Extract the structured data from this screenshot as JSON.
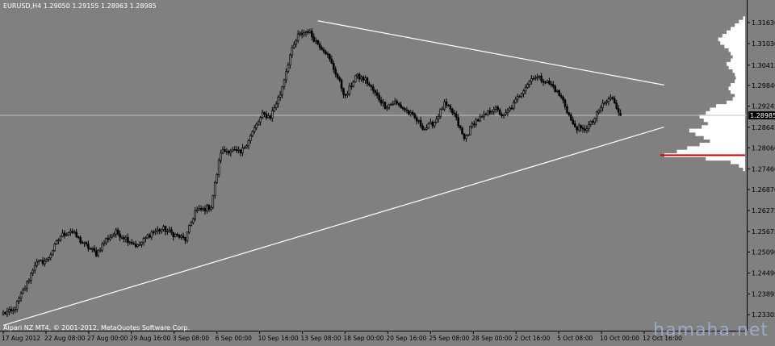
{
  "header": {
    "symbol_line": "EURUSD,H4  1.29050 1.29155 1.28963 1.28985"
  },
  "footer": {
    "copyright": "Alpari NZ MT4, © 2001-2012, MetaQuotes Software Corp."
  },
  "watermark": "hamaha.net",
  "colors": {
    "background": "#808080",
    "candle": "#000000",
    "trendline": "#ffffff",
    "price_line": "#c0c0c0",
    "axis_text": "#000000",
    "profile_fill": "#ffffff",
    "profile_peak": "#cc0000",
    "current_price_box": "#000000"
  },
  "chart_data": {
    "type": "candlestick",
    "symbol": "EURUSD",
    "timeframe": "H4",
    "current_price": 1.28985,
    "ohlc_last": {
      "open": 1.2905,
      "high": 1.29155,
      "low": 1.28963,
      "close": 1.28985
    },
    "ylim": [
      1.2285,
      1.3195
    ],
    "y_ticks": [
      1.3163,
      1.3103,
      1.30415,
      1.2984,
      1.29245,
      1.28645,
      1.2806,
      1.2746,
      1.2687,
      1.26275,
      1.25675,
      1.2509,
      1.2449,
      1.23895,
      1.23305
    ],
    "current_price_label": "1.28985",
    "x_ticks": [
      "17 Aug 2012",
      "22 Aug 08:00",
      "27 Aug 00:00",
      "29 Aug 16:00",
      "3 Sep 08:00",
      "6 Sep 00:00",
      "10 Sep 16:00",
      "13 Sep 08:00",
      "18 Sep 00:00",
      "20 Sep 16:00",
      "25 Sep 08:00",
      "28 Sep 00:00",
      "2 Oct 16:00",
      "5 Oct 08:00",
      "10 Oct 00:00",
      "12 Oct 16:00"
    ],
    "path_keypoints": [
      [
        0,
        1.2335
      ],
      [
        5,
        1.234
      ],
      [
        12,
        1.242
      ],
      [
        16,
        1.2475
      ],
      [
        22,
        1.2485
      ],
      [
        29,
        1.2555
      ],
      [
        34,
        1.257
      ],
      [
        40,
        1.2535
      ],
      [
        47,
        1.2505
      ],
      [
        52,
        1.2545
      ],
      [
        57,
        1.2565
      ],
      [
        63,
        1.2545
      ],
      [
        68,
        1.2525
      ],
      [
        75,
        1.2565
      ],
      [
        81,
        1.2575
      ],
      [
        86,
        1.256
      ],
      [
        92,
        1.2545
      ],
      [
        97,
        1.2625
      ],
      [
        101,
        1.263
      ],
      [
        105,
        1.264
      ],
      [
        110,
        1.2795
      ],
      [
        115,
        1.28
      ],
      [
        120,
        1.279
      ],
      [
        126,
        1.285
      ],
      [
        131,
        1.29
      ],
      [
        135,
        1.2895
      ],
      [
        140,
        1.296
      ],
      [
        145,
        1.307
      ],
      [
        149,
        1.3125
      ],
      [
        154,
        1.314
      ],
      [
        158,
        1.311
      ],
      [
        163,
        1.308
      ],
      [
        168,
        1.302
      ],
      [
        173,
        1.295
      ],
      [
        178,
        1.301
      ],
      [
        183,
        1.3
      ],
      [
        188,
        1.296
      ],
      [
        193,
        1.2925
      ],
      [
        198,
        1.2935
      ],
      [
        203,
        1.2915
      ],
      [
        208,
        1.289
      ],
      [
        213,
        1.286
      ],
      [
        218,
        1.288
      ],
      [
        223,
        1.293
      ],
      [
        228,
        1.29
      ],
      [
        233,
        1.283
      ],
      [
        238,
        1.288
      ],
      [
        243,
        1.2895
      ],
      [
        248,
        1.292
      ],
      [
        253,
        1.2895
      ],
      [
        258,
        1.293
      ],
      [
        263,
        1.2975
      ],
      [
        268,
        1.301
      ],
      [
        273,
        1.3
      ],
      [
        278,
        1.298
      ],
      [
        283,
        1.294
      ],
      [
        288,
        1.287
      ],
      [
        293,
        1.2855
      ],
      [
        298,
        1.288
      ],
      [
        303,
        1.293
      ],
      [
        308,
        1.295
      ],
      [
        312,
        1.29
      ]
    ],
    "n_candles": 313,
    "trendlines": [
      {
        "from": [
          0,
          1.23
        ],
        "to": [
          334,
          1.2865
        ]
      },
      {
        "from": [
          159,
          1.3168
        ],
        "to": [
          334,
          1.2985
        ]
      }
    ],
    "horizontal_lines": [
      1.28985
    ],
    "volume_profile": [
      [
        1.3175,
        2
      ],
      [
        1.3165,
        6
      ],
      [
        1.3155,
        10
      ],
      [
        1.3145,
        14
      ],
      [
        1.3135,
        18
      ],
      [
        1.3125,
        22
      ],
      [
        1.3115,
        26
      ],
      [
        1.3105,
        24
      ],
      [
        1.3095,
        20
      ],
      [
        1.3085,
        16
      ],
      [
        1.3075,
        14
      ],
      [
        1.3065,
        12
      ],
      [
        1.3055,
        14
      ],
      [
        1.3045,
        18
      ],
      [
        1.3035,
        16
      ],
      [
        1.3025,
        12
      ],
      [
        1.3015,
        10
      ],
      [
        1.3005,
        9
      ],
      [
        1.2995,
        10
      ],
      [
        1.2985,
        14
      ],
      [
        1.2975,
        16
      ],
      [
        1.2965,
        14
      ],
      [
        1.2955,
        10
      ],
      [
        1.2945,
        12
      ],
      [
        1.2935,
        18
      ],
      [
        1.2925,
        28
      ],
      [
        1.2915,
        34
      ],
      [
        1.2905,
        38
      ],
      [
        1.2895,
        44
      ],
      [
        1.2885,
        40
      ],
      [
        1.2875,
        36
      ],
      [
        1.2865,
        42
      ],
      [
        1.2855,
        54
      ],
      [
        1.2845,
        48
      ],
      [
        1.2835,
        40
      ],
      [
        1.2825,
        34
      ],
      [
        1.2815,
        44
      ],
      [
        1.2805,
        56
      ],
      [
        1.2795,
        66
      ],
      [
        1.2785,
        78
      ],
      [
        1.2775,
        38
      ],
      [
        1.2765,
        14
      ],
      [
        1.2755,
        6
      ],
      [
        1.2745,
        2
      ]
    ],
    "volume_profile_peak": 1.2785,
    "title": "",
    "xlabel": "",
    "ylabel": ""
  }
}
